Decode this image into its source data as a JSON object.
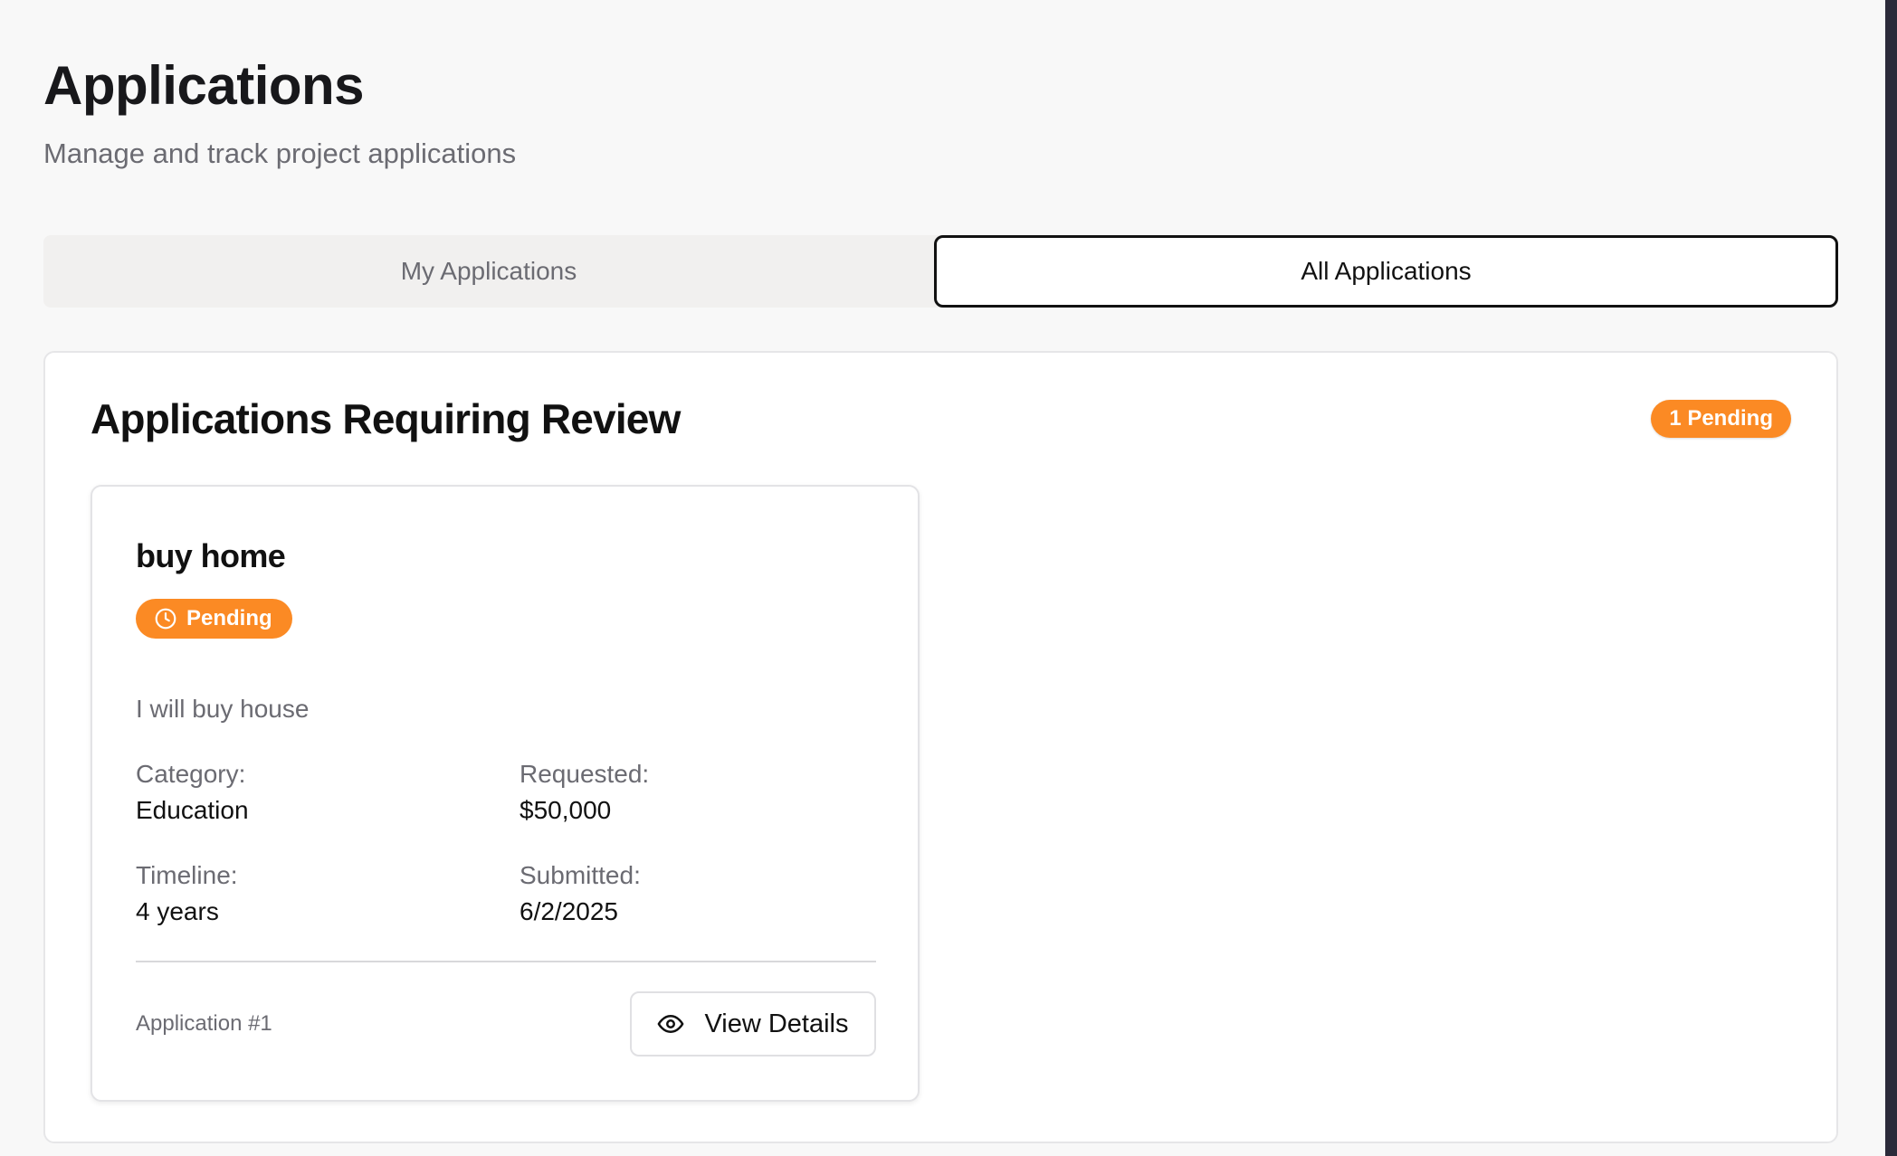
{
  "header": {
    "title": "Applications",
    "subtitle": "Manage and track project applications"
  },
  "tabs": [
    {
      "label": "My Applications",
      "active": false
    },
    {
      "label": "All Applications",
      "active": true
    }
  ],
  "review": {
    "title": "Applications Requiring Review",
    "pending_badge": "1 Pending",
    "accent_color": "#fb8a24"
  },
  "applications": [
    {
      "title": "buy home",
      "status": "Pending",
      "status_icon": "clock-icon",
      "description": "I will buy house",
      "category_label": "Category:",
      "category": "Education",
      "requested_label": "Requested:",
      "requested": "$50,000",
      "timeline_label": "Timeline:",
      "timeline": "4 years",
      "submitted_label": "Submitted:",
      "submitted": "6/2/2025",
      "number": "Application #1",
      "action_label": "View Details",
      "action_icon": "eye-icon"
    }
  ]
}
